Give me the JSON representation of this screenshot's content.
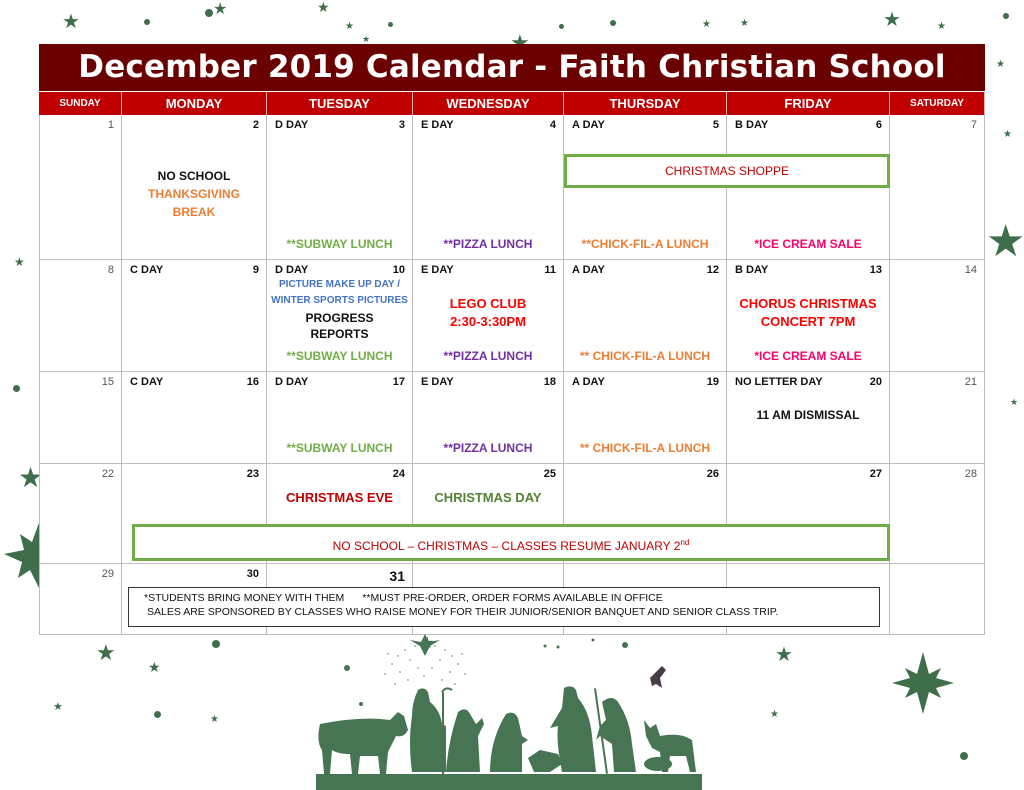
{
  "title": "December 2019 Calendar - Faith Christian School",
  "weekdays": [
    "SUNDAY",
    "MONDAY",
    "TUESDAY",
    "WEDNESDAY",
    "THURSDAY",
    "FRIDAY",
    "SATURDAY"
  ],
  "weeks": [
    [
      {
        "day": "1"
      },
      {
        "day": "2",
        "lines": [
          {
            "text": "NO SCHOOL",
            "color": "black"
          },
          {
            "text": "THANKSGIVING",
            "color": "orange"
          },
          {
            "text": "BREAK",
            "color": "orange"
          }
        ]
      },
      {
        "day": "3",
        "letter": "D DAY",
        "bottom": {
          "text": "**SUBWAY LUNCH",
          "color": "green"
        }
      },
      {
        "day": "4",
        "letter": "E DAY",
        "bottom": {
          "text": "**PIZZA LUNCH",
          "color": "purple"
        }
      },
      {
        "day": "5",
        "letter": "A DAY",
        "bottom": {
          "text": "**CHICK-FIL-A LUNCH",
          "color": "orange"
        }
      },
      {
        "day": "6",
        "letter": "B  DAY",
        "bottom": {
          "text": "*ICE CREAM SALE",
          "color": "pink"
        }
      },
      {
        "day": "7"
      }
    ],
    [
      {
        "day": "8"
      },
      {
        "day": "9",
        "letter": "C DAY"
      },
      {
        "day": "10",
        "letter": "D DAY",
        "lines": [
          {
            "text": "PICTURE MAKE UP DAY /",
            "color": "blue"
          },
          {
            "text": "WINTER SPORTS PICTURES",
            "color": "blue"
          },
          {
            "text": "PROGRESS",
            "color": "black"
          },
          {
            "text": "REPORTS",
            "color": "black"
          }
        ],
        "bottom": {
          "text": "**SUBWAY LUNCH",
          "color": "green"
        }
      },
      {
        "day": "11",
        "letter": "E DAY",
        "lines": [
          {
            "text": "LEGO CLUB",
            "color": "red"
          },
          {
            "text": "2:30-3:30PM",
            "color": "red"
          }
        ],
        "bottom": {
          "text": "**PIZZA LUNCH",
          "color": "purple"
        }
      },
      {
        "day": "12",
        "letter": "A DAY",
        "bottom": {
          "text": "** CHICK-FIL-A LUNCH",
          "color": "orange"
        }
      },
      {
        "day": "13",
        "letter": "B DAY",
        "lines": [
          {
            "text": "CHORUS CHRISTMAS",
            "color": "red"
          },
          {
            "text": "CONCERT 7PM",
            "color": "red"
          }
        ],
        "bottom": {
          "text": "*ICE CREAM SALE",
          "color": "pink"
        }
      },
      {
        "day": "14"
      }
    ],
    [
      {
        "day": "15"
      },
      {
        "day": "16",
        "letter": "C DAY"
      },
      {
        "day": "17",
        "letter": "D DAY",
        "bottom": {
          "text": "**SUBWAY LUNCH",
          "color": "green"
        }
      },
      {
        "day": "18",
        "letter": "E DAY",
        "bottom": {
          "text": "**PIZZA LUNCH",
          "color": "purple"
        }
      },
      {
        "day": "19",
        "letter": "A DAY",
        "bottom": {
          "text": "** CHICK-FIL-A LUNCH",
          "color": "orange"
        }
      },
      {
        "day": "20",
        "letter": "NO LETTER DAY",
        "lines": [
          {
            "text": "11 AM DISMISSAL",
            "color": "black"
          }
        ]
      },
      {
        "day": "21"
      }
    ],
    [
      {
        "day": "22"
      },
      {
        "day": "23"
      },
      {
        "day": "24",
        "lines": [
          {
            "text": "CHRISTMAS EVE",
            "color": "darkred"
          }
        ]
      },
      {
        "day": "25",
        "lines": [
          {
            "text": "CHRISTMAS DAY",
            "color": "xgreen"
          }
        ]
      },
      {
        "day": "26"
      },
      {
        "day": "27"
      },
      {
        "day": "28"
      }
    ],
    [
      {
        "day": "29"
      },
      {
        "day": "30"
      },
      {
        "day": "31"
      },
      {
        "day": ""
      },
      {
        "day": ""
      },
      {
        "day": ""
      },
      {
        "day": ""
      }
    ]
  ],
  "banners": {
    "christmas_shoppe": "CHRISTMAS SHOPPE",
    "christmas_break": "NO SCHOOL – CHRISTMAS – CLASSES RESUME JANUARY 2",
    "christmas_break_sup": "nd"
  },
  "notes": {
    "line1_a": "*STUDENTS BRING MONEY WITH THEM",
    "line1_b": "**MUST PRE-ORDER, ORDER FORMS AVAILABLE IN OFFICE",
    "line2": "SALES ARE SPONSORED BY CLASSES WHO RAISE MONEY FOR THEIR JUNIOR/SENIOR BANQUET AND SENIOR CLASS TRIP."
  },
  "colors": {
    "title_bg": "#6b0000",
    "header_bg": "#c00000",
    "banner_border": "#70ad47",
    "decor_green": "#3f6f4a"
  }
}
